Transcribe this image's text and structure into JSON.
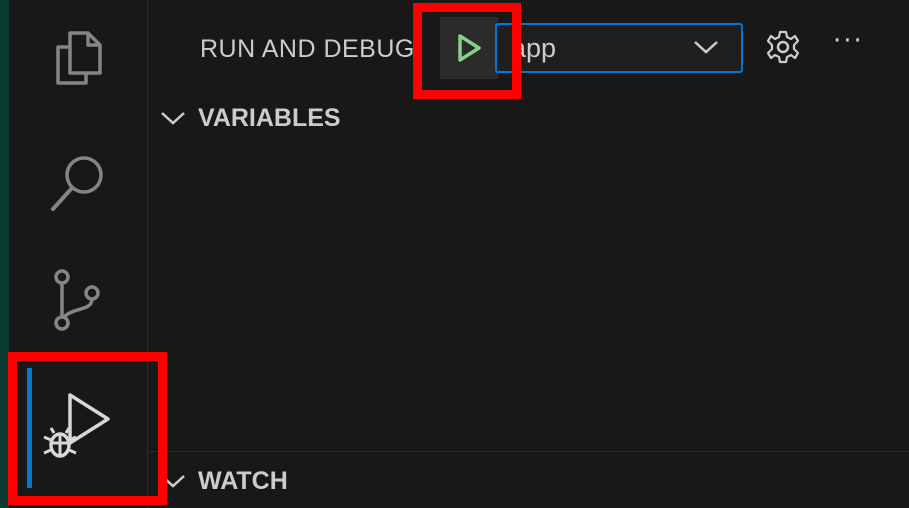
{
  "activity_bar": {
    "items": [
      {
        "icon": "explorer-files-icon"
      },
      {
        "icon": "search-icon"
      },
      {
        "icon": "source-control-icon"
      },
      {
        "icon": "run-and-debug-icon",
        "active": true
      }
    ]
  },
  "sidebar": {
    "title": "RUN AND DEBUG",
    "run_button": {
      "icon": "play-icon",
      "color": "#89d185"
    },
    "config_select": {
      "value": "app"
    },
    "sections": [
      {
        "label": "VARIABLES",
        "expanded": true
      },
      {
        "label": "WATCH",
        "expanded": true
      }
    ]
  },
  "colors": {
    "background": "#181818",
    "accent": "#0078d4",
    "highlight_box": "#ff0000",
    "play_green": "#89d185"
  }
}
